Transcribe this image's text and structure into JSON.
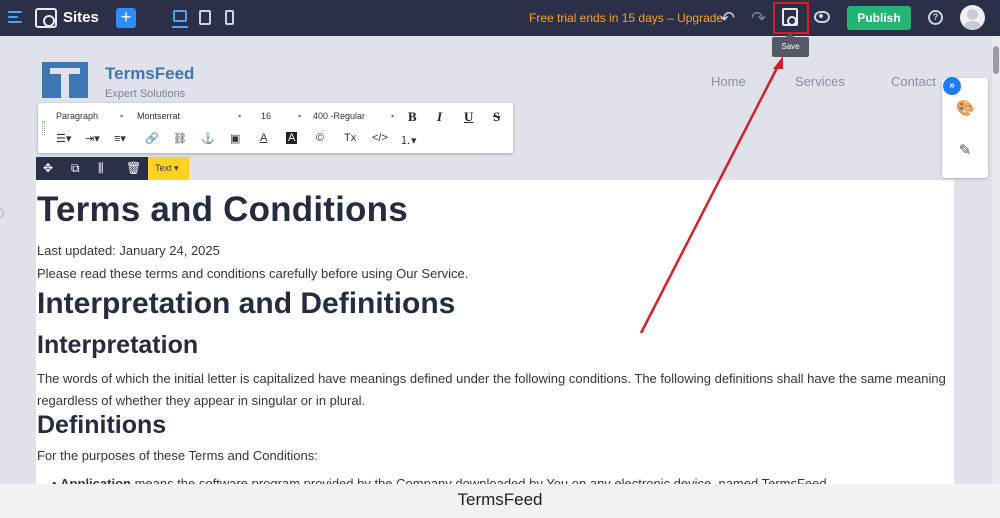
{
  "topbar": {
    "app_label": "Sites",
    "add_label": "+",
    "trial_text": "Free trial ends in 15 days – Upgrade",
    "undo_glyph": "↶",
    "redo_glyph": "↷",
    "publish_label": "Publish",
    "help_glyph": "?",
    "accent_color": "#2d8cff",
    "publish_color": "#22b573",
    "trial_color": "#f5a623"
  },
  "tooltip": {
    "save_label": "Save"
  },
  "site_header": {
    "brand": "TermsFeed",
    "tagline": "Expert Solutions",
    "nav": [
      "Home",
      "Services",
      "Contact"
    ]
  },
  "format_toolbar": {
    "block_type": "Paragraph",
    "font_family": "Montserrat",
    "font_size": "16",
    "font_weight": "400 -Regular",
    "bold": "B",
    "italic": "I",
    "underline": "U",
    "strike": "S",
    "row2_icons": [
      "align-left-icon",
      "indent-icon",
      "list-icon",
      "link-icon",
      "unlink-icon",
      "anchor-icon",
      "image-icon",
      "text-color-icon",
      "bg-color-icon",
      "copyright-icon",
      "clear-format-icon",
      "code-icon",
      "ordered-list-icon"
    ]
  },
  "element_bar": {
    "move_glyph": "✥",
    "copy_glyph": "⧉",
    "settings_glyph": "⫼",
    "delete_glyph": "🗑",
    "type_chip": "Text ▾"
  },
  "content": {
    "h1": "Terms and Conditions",
    "last_updated": "Last updated: January 24, 2025",
    "intro": "Please read these terms and conditions carefully before using Our Service.",
    "h2": "Interpretation and Definitions",
    "h3_interpretation": "Interpretation",
    "interpretation_text": "The words of which the initial letter is capitalized have meanings defined under the following conditions. The following definitions shall have the same meaning regardless of whether they appear in singular or in plural.",
    "h3_definitions": "Definitions",
    "definitions_intro": "For the purposes of these Terms and Conditions:",
    "application_term": "Application",
    "application_text": " means the software program provided by the Company downloaded by You on any electronic device, named TermsFeed"
  },
  "side_panel": {
    "toggle_glyph": "»"
  },
  "caption": "TermsFeed"
}
